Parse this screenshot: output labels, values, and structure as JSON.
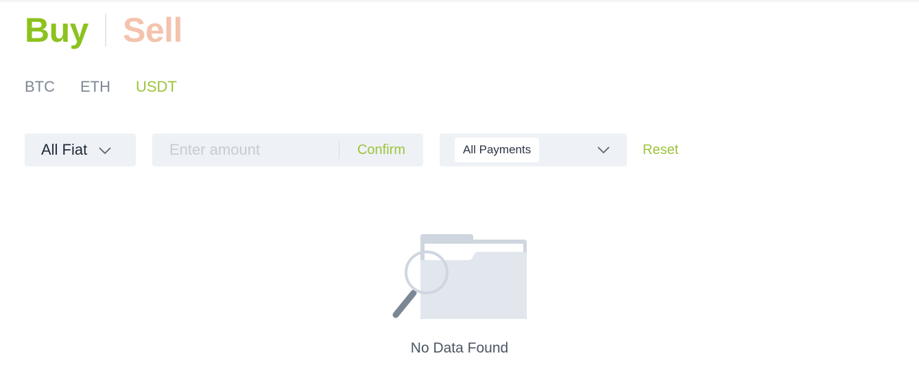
{
  "trade_toggle": {
    "buy_label": "Buy",
    "sell_label": "Sell",
    "active": "Buy"
  },
  "asset_tabs": [
    {
      "label": "BTC",
      "active": false
    },
    {
      "label": "ETH",
      "active": false
    },
    {
      "label": "USDT",
      "active": true
    }
  ],
  "filters": {
    "fiat_select": "All Fiat",
    "amount_placeholder": "Enter amount",
    "amount_value": "",
    "confirm_label": "Confirm",
    "payment_select": "All Payments",
    "reset_label": "Reset"
  },
  "empty_state": {
    "message": "No Data Found",
    "icon": "empty-folder-search-icon"
  },
  "colors": {
    "accent_green": "#8cc21e",
    "sell_inactive": "#f3c3ad",
    "link_green": "#9cc43c",
    "field_bg": "#eef1f5"
  }
}
